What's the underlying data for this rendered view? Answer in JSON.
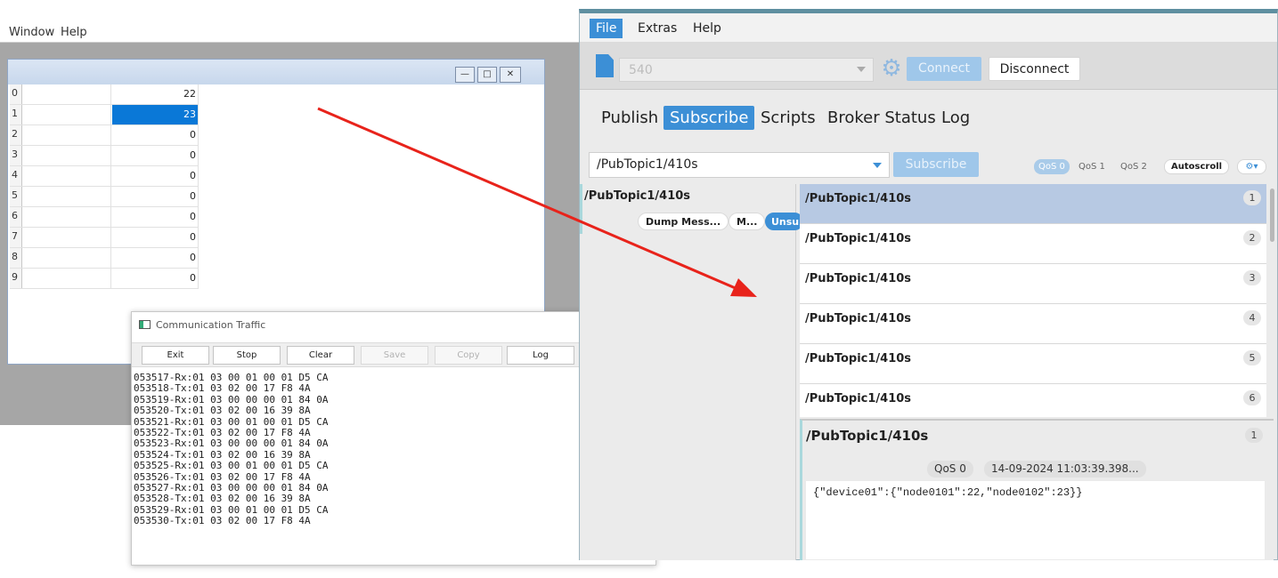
{
  "bg_app": {
    "menu": [
      "Window",
      "Help"
    ],
    "rows": [
      {
        "index": "0",
        "value": "22"
      },
      {
        "index": "1",
        "value": "23"
      },
      {
        "index": "2",
        "value": "0"
      },
      {
        "index": "3",
        "value": "0"
      },
      {
        "index": "4",
        "value": "0"
      },
      {
        "index": "5",
        "value": "0"
      },
      {
        "index": "6",
        "value": "0"
      },
      {
        "index": "7",
        "value": "0"
      },
      {
        "index": "8",
        "value": "0"
      },
      {
        "index": "9",
        "value": "0"
      }
    ]
  },
  "traffic": {
    "title": "Communication Traffic",
    "buttons": {
      "exit": "Exit",
      "stop": "Stop",
      "clear": "Clear",
      "save": "Save",
      "copy": "Copy",
      "log": "Log"
    },
    "lines": [
      "053517-Rx:01 03 00 01 00 01 D5 CA",
      "053518-Tx:01 03 02 00 17 F8 4A",
      "053519-Rx:01 03 00 00 00 01 84 0A",
      "053520-Tx:01 03 02 00 16 39 8A",
      "053521-Rx:01 03 00 01 00 01 D5 CA",
      "053522-Tx:01 03 02 00 17 F8 4A",
      "053523-Rx:01 03 00 00 00 01 84 0A",
      "053524-Tx:01 03 02 00 16 39 8A",
      "053525-Rx:01 03 00 01 00 01 D5 CA",
      "053526-Tx:01 03 02 00 17 F8 4A",
      "053527-Rx:01 03 00 00 00 01 84 0A",
      "053528-Tx:01 03 02 00 16 39 8A",
      "053529-Rx:01 03 00 01 00 01 D5 CA",
      "053530-Tx:01 03 02 00 17 F8 4A"
    ]
  },
  "mqtt": {
    "menu": {
      "file": "File",
      "extras": "Extras",
      "help": "Help"
    },
    "toolbar": {
      "profile": "540",
      "connect": "Connect",
      "disconnect": "Disconnect"
    },
    "tabs": {
      "publish": "Publish",
      "subscribe": "Subscribe",
      "scripts": "Scripts",
      "broker_status": "Broker Status",
      "log": "Log"
    },
    "subscribe_bar": {
      "topic": "/PubTopic1/410s",
      "subscribe_label": "Subscribe",
      "qos0": "QoS 0",
      "qos1": "QoS 1",
      "qos2": "QoS 2",
      "autoscroll": "Autoscroll"
    },
    "subscription": {
      "topic": "/PubTopic1/410s",
      "dump": "Dump Mess...",
      "mute": "M...",
      "unsub": "Unsu"
    },
    "messages": [
      {
        "topic": "/PubTopic1/410s",
        "num": "1"
      },
      {
        "topic": "/PubTopic1/410s",
        "num": "2"
      },
      {
        "topic": "/PubTopic1/410s",
        "num": "3"
      },
      {
        "topic": "/PubTopic1/410s",
        "num": "4"
      },
      {
        "topic": "/PubTopic1/410s",
        "num": "5"
      },
      {
        "topic": "/PubTopic1/410s",
        "num": "6"
      }
    ],
    "detail": {
      "topic": "/PubTopic1/410s",
      "num": "1",
      "qos": "QoS 0",
      "timestamp": "14-09-2024  11:03:39.398...",
      "payload": "{\"device01\":{\"node0101\":22,\"node0102\":23}}"
    },
    "colors": {
      "accent": "#3c8fd6",
      "arrow": "#e8231b"
    }
  }
}
